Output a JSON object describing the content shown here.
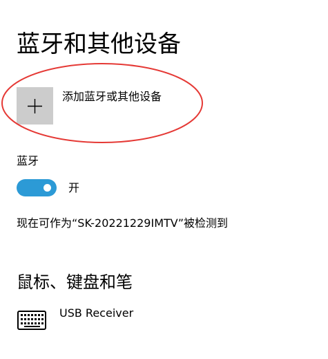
{
  "page": {
    "title": "蓝牙和其他设备"
  },
  "add_device": {
    "label": "添加蓝牙或其他设备",
    "icon": "plus-icon"
  },
  "bluetooth": {
    "heading": "蓝牙",
    "toggle_state": "开",
    "toggle_on": true,
    "accent_color": "#2c9ad6",
    "discoverable_text": "现在可作为“SK-20221229IMTV”被检测到"
  },
  "mouse_keyboard_pen": {
    "heading": "鼠标、键盘和笔",
    "devices": [
      {
        "name": "USB Receiver",
        "icon": "keyboard-icon"
      }
    ]
  },
  "annotation": {
    "shape": "ellipse",
    "color": "#e53935"
  }
}
